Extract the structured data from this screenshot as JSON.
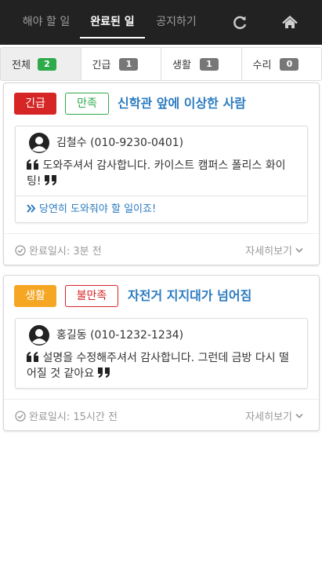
{
  "nav": {
    "tabs": [
      {
        "label": "해야 할 일"
      },
      {
        "label": "완료된 일"
      },
      {
        "label": "공지하기"
      }
    ],
    "active_tab": "완료된 일",
    "icons": [
      "refresh-icon",
      "home-icon"
    ]
  },
  "filters": [
    {
      "label": "전체",
      "count": "2"
    },
    {
      "label": "긴급",
      "count": "1"
    },
    {
      "label": "생활",
      "count": "1"
    },
    {
      "label": "수리",
      "count": "0"
    }
  ],
  "cards": [
    {
      "category": "긴급",
      "rating": "만족",
      "title": "신학관 앞에 이상한 사람",
      "user": "김철수 (010-9230-0401)",
      "quote": "도와주셔서 감사합니다. 카이스트 캠퍼스 폴리스 화이팅!",
      "reply": "당연히 도와줘야 할 일이죠!",
      "completed": "완료일시: 3분 전",
      "more_label": "자세히보기"
    },
    {
      "category": "생활",
      "rating": "불만족",
      "title": "자전거 지지대가 넘어짐",
      "user": "홍길동 (010-1232-1234)",
      "quote": "설명을 수정해주셔서 감사합니다. 그런데 금방 다시 떨어질 것 같아요",
      "completed": "완료일시: 15시간 전",
      "more_label": "자세히보기"
    }
  ],
  "colors": {
    "nav_bg": "#222222",
    "urgent": "#d62525",
    "life": "#f5a623",
    "satisfied": "#2eaa4a",
    "title_link": "#2b7bc0"
  }
}
